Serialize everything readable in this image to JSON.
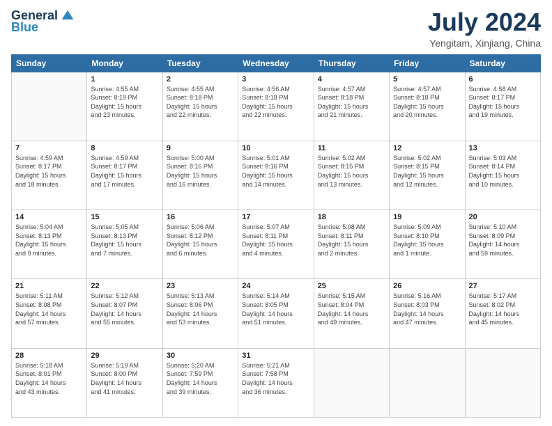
{
  "header": {
    "logo_general": "General",
    "logo_blue": "Blue",
    "month_title": "July 2024",
    "location": "Yengitam, Xinjiang, China"
  },
  "weekdays": [
    "Sunday",
    "Monday",
    "Tuesday",
    "Wednesday",
    "Thursday",
    "Friday",
    "Saturday"
  ],
  "weeks": [
    [
      {
        "day": "",
        "info": ""
      },
      {
        "day": "1",
        "info": "Sunrise: 4:55 AM\nSunset: 8:19 PM\nDaylight: 15 hours\nand 23 minutes."
      },
      {
        "day": "2",
        "info": "Sunrise: 4:55 AM\nSunset: 8:18 PM\nDaylight: 15 hours\nand 22 minutes."
      },
      {
        "day": "3",
        "info": "Sunrise: 4:56 AM\nSunset: 8:18 PM\nDaylight: 15 hours\nand 22 minutes."
      },
      {
        "day": "4",
        "info": "Sunrise: 4:57 AM\nSunset: 8:18 PM\nDaylight: 15 hours\nand 21 minutes."
      },
      {
        "day": "5",
        "info": "Sunrise: 4:57 AM\nSunset: 8:18 PM\nDaylight: 15 hours\nand 20 minutes."
      },
      {
        "day": "6",
        "info": "Sunrise: 4:58 AM\nSunset: 8:17 PM\nDaylight: 15 hours\nand 19 minutes."
      }
    ],
    [
      {
        "day": "7",
        "info": "Sunrise: 4:59 AM\nSunset: 8:17 PM\nDaylight: 15 hours\nand 18 minutes."
      },
      {
        "day": "8",
        "info": "Sunrise: 4:59 AM\nSunset: 8:17 PM\nDaylight: 15 hours\nand 17 minutes."
      },
      {
        "day": "9",
        "info": "Sunrise: 5:00 AM\nSunset: 8:16 PM\nDaylight: 15 hours\nand 16 minutes."
      },
      {
        "day": "10",
        "info": "Sunrise: 5:01 AM\nSunset: 8:16 PM\nDaylight: 15 hours\nand 14 minutes."
      },
      {
        "day": "11",
        "info": "Sunrise: 5:02 AM\nSunset: 8:15 PM\nDaylight: 15 hours\nand 13 minutes."
      },
      {
        "day": "12",
        "info": "Sunrise: 5:02 AM\nSunset: 8:15 PM\nDaylight: 15 hours\nand 12 minutes."
      },
      {
        "day": "13",
        "info": "Sunrise: 5:03 AM\nSunset: 8:14 PM\nDaylight: 15 hours\nand 10 minutes."
      }
    ],
    [
      {
        "day": "14",
        "info": "Sunrise: 5:04 AM\nSunset: 8:13 PM\nDaylight: 15 hours\nand 9 minutes."
      },
      {
        "day": "15",
        "info": "Sunrise: 5:05 AM\nSunset: 8:13 PM\nDaylight: 15 hours\nand 7 minutes."
      },
      {
        "day": "16",
        "info": "Sunrise: 5:06 AM\nSunset: 8:12 PM\nDaylight: 15 hours\nand 6 minutes."
      },
      {
        "day": "17",
        "info": "Sunrise: 5:07 AM\nSunset: 8:11 PM\nDaylight: 15 hours\nand 4 minutes."
      },
      {
        "day": "18",
        "info": "Sunrise: 5:08 AM\nSunset: 8:11 PM\nDaylight: 15 hours\nand 2 minutes."
      },
      {
        "day": "19",
        "info": "Sunrise: 5:09 AM\nSunset: 8:10 PM\nDaylight: 15 hours\nand 1 minute."
      },
      {
        "day": "20",
        "info": "Sunrise: 5:10 AM\nSunset: 8:09 PM\nDaylight: 14 hours\nand 59 minutes."
      }
    ],
    [
      {
        "day": "21",
        "info": "Sunrise: 5:11 AM\nSunset: 8:08 PM\nDaylight: 14 hours\nand 57 minutes."
      },
      {
        "day": "22",
        "info": "Sunrise: 5:12 AM\nSunset: 8:07 PM\nDaylight: 14 hours\nand 55 minutes."
      },
      {
        "day": "23",
        "info": "Sunrise: 5:13 AM\nSunset: 8:06 PM\nDaylight: 14 hours\nand 53 minutes."
      },
      {
        "day": "24",
        "info": "Sunrise: 5:14 AM\nSunset: 8:05 PM\nDaylight: 14 hours\nand 51 minutes."
      },
      {
        "day": "25",
        "info": "Sunrise: 5:15 AM\nSunset: 8:04 PM\nDaylight: 14 hours\nand 49 minutes."
      },
      {
        "day": "26",
        "info": "Sunrise: 5:16 AM\nSunset: 8:03 PM\nDaylight: 14 hours\nand 47 minutes."
      },
      {
        "day": "27",
        "info": "Sunrise: 5:17 AM\nSunset: 8:02 PM\nDaylight: 14 hours\nand 45 minutes."
      }
    ],
    [
      {
        "day": "28",
        "info": "Sunrise: 5:18 AM\nSunset: 8:01 PM\nDaylight: 14 hours\nand 43 minutes."
      },
      {
        "day": "29",
        "info": "Sunrise: 5:19 AM\nSunset: 8:00 PM\nDaylight: 14 hours\nand 41 minutes."
      },
      {
        "day": "30",
        "info": "Sunrise: 5:20 AM\nSunset: 7:59 PM\nDaylight: 14 hours\nand 39 minutes."
      },
      {
        "day": "31",
        "info": "Sunrise: 5:21 AM\nSunset: 7:58 PM\nDaylight: 14 hours\nand 36 minutes."
      },
      {
        "day": "",
        "info": ""
      },
      {
        "day": "",
        "info": ""
      },
      {
        "day": "",
        "info": ""
      }
    ]
  ]
}
